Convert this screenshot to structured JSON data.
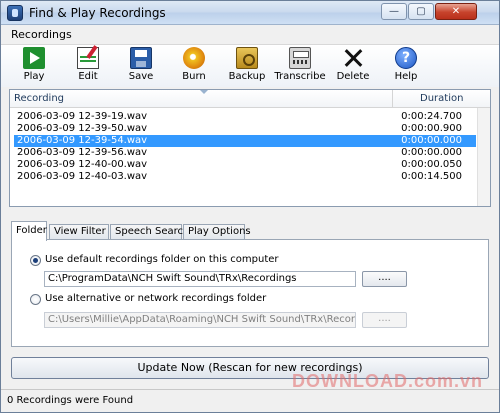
{
  "window": {
    "title": "Find & Play Recordings"
  },
  "menu": {
    "recordings": "Recordings"
  },
  "toolbar": {
    "items": [
      {
        "label": "Play",
        "icon": "play-icon"
      },
      {
        "label": "Edit",
        "icon": "edit-icon"
      },
      {
        "label": "Save",
        "icon": "save-icon"
      },
      {
        "label": "Burn",
        "icon": "burn-icon"
      },
      {
        "label": "Backup",
        "icon": "backup-icon"
      },
      {
        "label": "Transcribe",
        "icon": "transcribe-icon"
      },
      {
        "label": "Delete",
        "icon": "delete-icon"
      },
      {
        "label": "Help",
        "icon": "help-icon"
      }
    ]
  },
  "list": {
    "headers": {
      "recording": "Recording",
      "duration": "Duration"
    },
    "rows": [
      {
        "name": "2006-03-09 12-39-19.wav",
        "duration": "0:00:24.700"
      },
      {
        "name": "2006-03-09 12-39-50.wav",
        "duration": "0:00:00.900"
      },
      {
        "name": "2006-03-09 12-39-54.wav",
        "duration": "0:00:00.000",
        "selected": true
      },
      {
        "name": "2006-03-09 12-39-56.wav",
        "duration": "0:00:00.000"
      },
      {
        "name": "2006-03-09 12-40-00.wav",
        "duration": "0:00:00.050"
      },
      {
        "name": "2006-03-09 12-40-03.wav",
        "duration": "0:00:14.500"
      }
    ]
  },
  "tabs": [
    "Folder",
    "View Filter",
    "Speech Search",
    "Play Options"
  ],
  "folder": {
    "default_option": "Use default recordings folder on this computer",
    "default_path": "C:\\ProgramData\\NCH Swift Sound\\TRx\\Recordings",
    "alt_option": "Use alternative or network recordings folder",
    "alt_path": "C:\\Users\\Millie\\AppData\\Roaming\\NCH Swift Sound\\TRx\\Recordings",
    "browse_label": "...."
  },
  "update_button": "Update Now (Rescan for new recordings)",
  "status": "0 Recordings were Found",
  "watermark": "DOWNLOAD.com.vn",
  "window_buttons": {
    "minimize": "—",
    "maximize": "▢",
    "close": "✕"
  },
  "colors": {
    "selection": "#3399ff",
    "accent": "#1c57c4"
  }
}
